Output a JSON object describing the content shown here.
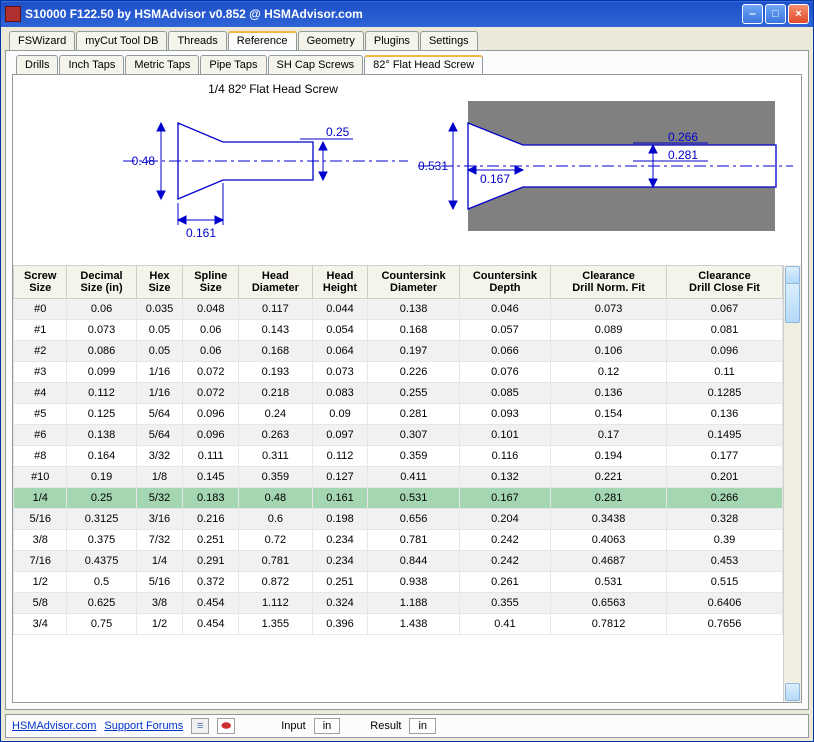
{
  "window": {
    "title": "S10000 F122.50 by HSMAdvisor v0.852 @ HSMAdvisor.com"
  },
  "top_tabs": [
    "FSWizard",
    "myCut Tool DB",
    "Threads",
    "Reference",
    "Geometry",
    "Plugins",
    "Settings"
  ],
  "top_tab_active": 3,
  "sub_tabs": [
    "Drills",
    "Inch Taps",
    "Metric Taps",
    "Pipe Taps",
    "SH Cap Screws",
    "82° Flat Head Screw"
  ],
  "sub_tab_active": 5,
  "diagram": {
    "title": "1/4 82º Flat Head Screw",
    "left": {
      "head_dia": "0.48",
      "shank_dia": "0.25",
      "head_height": "0.161"
    },
    "right": {
      "cs_dia": "0.531",
      "cs_depth": "0.167",
      "clr_close": "0.266",
      "clr_norm": "0.281"
    }
  },
  "columns": [
    "Screw Size",
    "Decimal Size (in)",
    "Hex Size",
    "Spline Size",
    "Head Diameter",
    "Head Height",
    "Countersink Diameter",
    "Countersink Depth",
    "Clearance Drill Norm. Fit",
    "Clearance Drill Close Fit"
  ],
  "rows": [
    [
      "#0",
      "0.06",
      "0.035",
      "0.048",
      "0.117",
      "0.044",
      "0.138",
      "0.046",
      "0.073",
      "0.067"
    ],
    [
      "#1",
      "0.073",
      "0.05",
      "0.06",
      "0.143",
      "0.054",
      "0.168",
      "0.057",
      "0.089",
      "0.081"
    ],
    [
      "#2",
      "0.086",
      "0.05",
      "0.06",
      "0.168",
      "0.064",
      "0.197",
      "0.066",
      "0.106",
      "0.096"
    ],
    [
      "#3",
      "0.099",
      "1/16",
      "0.072",
      "0.193",
      "0.073",
      "0.226",
      "0.076",
      "0.12",
      "0.11"
    ],
    [
      "#4",
      "0.112",
      "1/16",
      "0.072",
      "0.218",
      "0.083",
      "0.255",
      "0.085",
      "0.136",
      "0.1285"
    ],
    [
      "#5",
      "0.125",
      "5/64",
      "0.096",
      "0.24",
      "0.09",
      "0.281",
      "0.093",
      "0.154",
      "0.136"
    ],
    [
      "#6",
      "0.138",
      "5/64",
      "0.096",
      "0.263",
      "0.097",
      "0.307",
      "0.101",
      "0.17",
      "0.1495"
    ],
    [
      "#8",
      "0.164",
      "3/32",
      "0.111",
      "0.311",
      "0.112",
      "0.359",
      "0.116",
      "0.194",
      "0.177"
    ],
    [
      "#10",
      "0.19",
      "1/8",
      "0.145",
      "0.359",
      "0.127",
      "0.411",
      "0.132",
      "0.221",
      "0.201"
    ],
    [
      "1/4",
      "0.25",
      "5/32",
      "0.183",
      "0.48",
      "0.161",
      "0.531",
      "0.167",
      "0.281",
      "0.266"
    ],
    [
      "5/16",
      "0.3125",
      "3/16",
      "0.216",
      "0.6",
      "0.198",
      "0.656",
      "0.204",
      "0.3438",
      "0.328"
    ],
    [
      "3/8",
      "0.375",
      "7/32",
      "0.251",
      "0.72",
      "0.234",
      "0.781",
      "0.242",
      "0.4063",
      "0.39"
    ],
    [
      "7/16",
      "0.4375",
      "1/4",
      "0.291",
      "0.781",
      "0.234",
      "0.844",
      "0.242",
      "0.4687",
      "0.453"
    ],
    [
      "1/2",
      "0.5",
      "5/16",
      "0.372",
      "0.872",
      "0.251",
      "0.938",
      "0.261",
      "0.531",
      "0.515"
    ],
    [
      "5/8",
      "0.625",
      "3/8",
      "0.454",
      "1.112",
      "0.324",
      "1.188",
      "0.355",
      "0.6563",
      "0.6406"
    ],
    [
      "3/4",
      "0.75",
      "1/2",
      "0.454",
      "1.355",
      "0.396",
      "1.438",
      "0.41",
      "0.7812",
      "0.7656"
    ]
  ],
  "selected_row": 9,
  "status": {
    "link1": "HSMAdvisor.com",
    "link2": "Support Forums",
    "input_label": "Input",
    "input_unit": "in",
    "result_label": "Result",
    "result_unit": "in"
  }
}
